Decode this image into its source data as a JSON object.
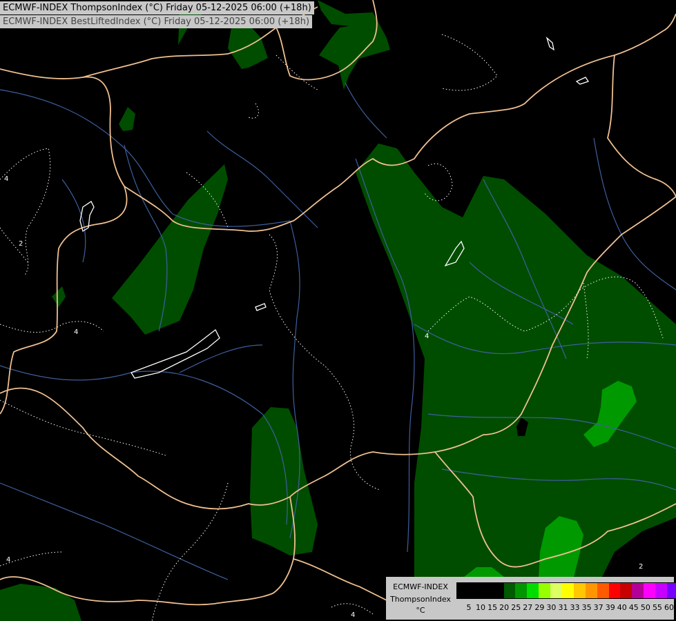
{
  "titles": {
    "line1": "ECMWF-INDEX ThompsonIndex (°C) Friday 05-12-2025 06:00 (+18h)",
    "line2": "ECMWF-INDEX BestLiftedIndex (°C) Friday 05-12-2025 06:00 (+18h)"
  },
  "contour_labels": [
    "4",
    "2",
    "4",
    "4",
    "4",
    "2",
    "4"
  ],
  "legend": {
    "line1": "ECMWF-INDEX",
    "line2": "ThompsonIndex",
    "line3": "°C",
    "colors": [
      "#000000",
      "#000000",
      "#000000",
      "#000000",
      "#005a00",
      "#009600",
      "#00dc00",
      "#96ff00",
      "#dcff64",
      "#ffff00",
      "#ffc800",
      "#ff9600",
      "#ff5a00",
      "#ff0000",
      "#c80000",
      "#b40096",
      "#ff00ff",
      "#c800ff",
      "#7800ff",
      "#4600ff",
      "#0000ff"
    ],
    "ticks": [
      "5",
      "10",
      "15",
      "20",
      "25",
      "27",
      "29",
      "30",
      "31",
      "33",
      "35",
      "37",
      "39",
      "40",
      "45",
      "50",
      "55",
      "60"
    ]
  }
}
